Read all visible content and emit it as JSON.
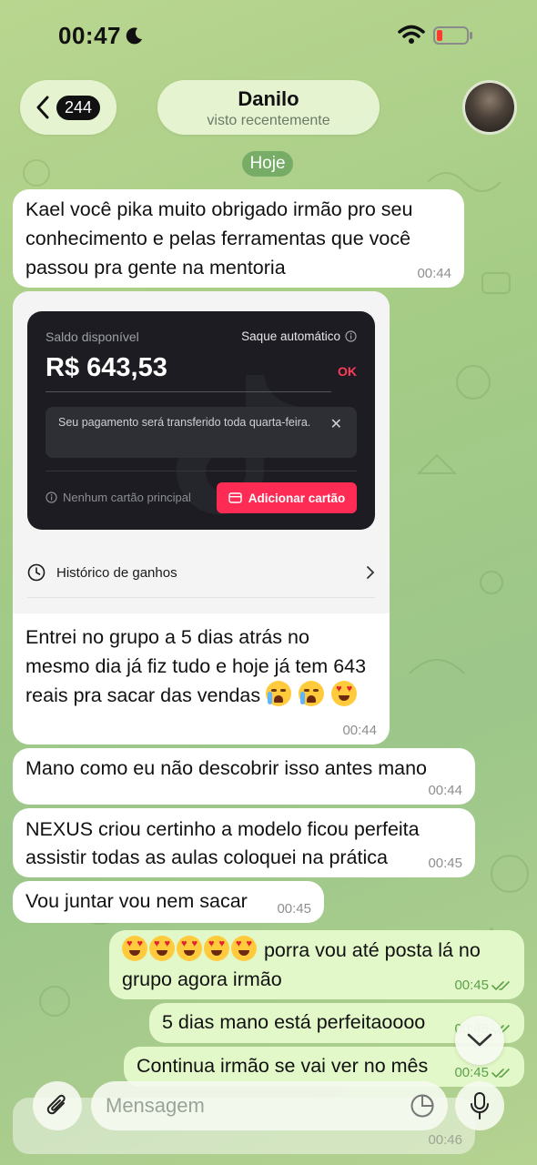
{
  "status": {
    "time": "00:47"
  },
  "header": {
    "back_count": "244",
    "name": "Danilo",
    "subtitle": "visto recentemente"
  },
  "date_separator": "Hoje",
  "messages": [
    {
      "dir": "in",
      "text": "Kael você pika muito obrigado irmão pro seu conhecimento e pelas ferramentas que você passou pra gente na mentoria",
      "time": "00:44"
    },
    {
      "dir": "in",
      "text": "Entrei no grupo a 5 dias  atrás no mesmo dia já fiz tudo e hoje já tem 643 reais pra sacar das vendas",
      "time": "00:44"
    },
    {
      "dir": "in",
      "text": "Mano como eu não descobrir isso antes mano",
      "time": "00:44"
    },
    {
      "dir": "in",
      "text": "NEXUS criou certinho a modelo ficou perfeita assistir todas as aulas coloquei na prática",
      "time": "00:45"
    },
    {
      "dir": "in",
      "text": "Vou juntar vou nem sacar",
      "time": "00:45"
    },
    {
      "dir": "out",
      "text": " porra vou até posta lá no grupo agora irmão",
      "time": "00:45"
    },
    {
      "dir": "out",
      "text": "5 dias mano está perfeitaoooo",
      "time": "00:45"
    },
    {
      "dir": "out",
      "text": "Continua irmão se vai ver no mês",
      "time": "00:45"
    },
    {
      "dir": "in",
      "text": "",
      "time": "00:46"
    }
  ],
  "payout_card": {
    "balance_label": "Saldo disponível",
    "auto_withdraw_label": "Saque automático",
    "amount": "R$ 643,53",
    "ok_label": "OK",
    "notice": "Seu pagamento será transferido toda quarta-feira.",
    "no_card_label": "Nenhum cartão principal",
    "add_card_label": "Adicionar cartão",
    "history_label": "Histórico de ganhos"
  },
  "composer": {
    "placeholder": "Mensagem"
  },
  "colors": {
    "accent_green": "#5aa148",
    "tiktok_red": "#fe2c55",
    "outgoing_bubble": "#e2f8c8"
  }
}
